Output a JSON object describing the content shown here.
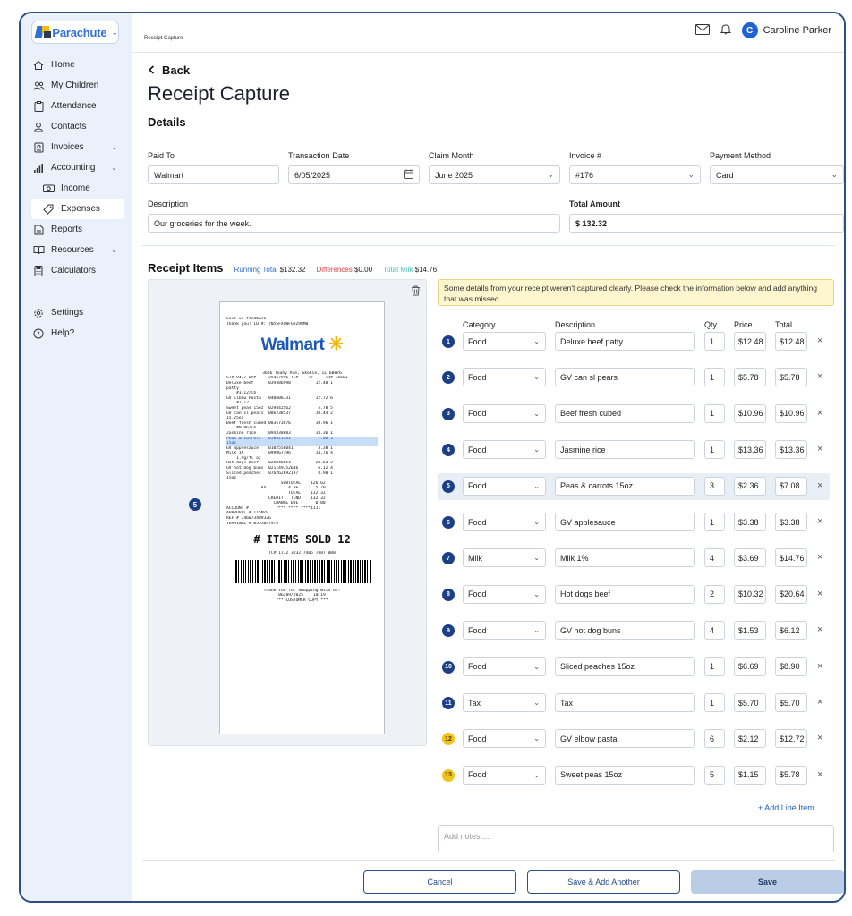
{
  "brand": {
    "name": "Parachute",
    "sub": "by brillant"
  },
  "sidebar": {
    "items": [
      {
        "label": "Home",
        "icon": "home-icon"
      },
      {
        "label": "My Children",
        "icon": "users-icon"
      },
      {
        "label": "Attendance",
        "icon": "clipboard-icon"
      },
      {
        "label": "Contacts",
        "icon": "user-icon"
      },
      {
        "label": "Invoices",
        "icon": "invoice-icon"
      },
      {
        "label": "Accounting",
        "icon": "bar-chart-icon"
      },
      {
        "label": "Income",
        "icon": "cash-icon"
      },
      {
        "label": "Expenses",
        "icon": "tag-icon"
      },
      {
        "label": "Reports",
        "icon": "report-icon"
      },
      {
        "label": "Resources",
        "icon": "book-icon"
      },
      {
        "label": "Calculators",
        "icon": "calculator-icon"
      },
      {
        "label": "Settings",
        "icon": "gear-icon"
      },
      {
        "label": "Help?",
        "icon": "help-icon"
      }
    ]
  },
  "topbar": {
    "breadcrumb": "Receipt Capture",
    "avatar_initial": "C",
    "user_name": "Caroline Parker"
  },
  "page": {
    "back": "Back",
    "title": "Receipt Capture",
    "details_title": "Details"
  },
  "details": {
    "paid_to_label": "Paid To",
    "paid_to": "Walmart",
    "transaction_date_label": "Transaction Date",
    "transaction_date": "6/05/2025",
    "claim_month_label": "Claim Month",
    "claim_month": "June 2025",
    "invoice_label": "Invoice #",
    "invoice": "#176",
    "payment_method_label": "Payment Method",
    "payment_method": "Card",
    "description_label": "Description",
    "description": "Our groceries for the week.",
    "total_label": "Total Amount",
    "total": "$ 132.32"
  },
  "items_header": {
    "title": "Receipt Items",
    "running_total_label": "Running Total",
    "running_total": "$132.32",
    "differences_label": "Differences",
    "differences": "$0.00",
    "total_milk_label": "Total Milk",
    "total_milk": "$14.76"
  },
  "warning": "Some details from your receipt weren't captured clearly. Please check the information below and add anything that was missed.",
  "columns": {
    "category": "Category",
    "description": "Description",
    "qty": "Qty",
    "price": "Price",
    "total": "Total"
  },
  "line_items": [
    {
      "n": "1",
      "category": "Food",
      "description": "Deluxe beef patty",
      "qty": "1",
      "price": "$12.48",
      "total": "$12.48"
    },
    {
      "n": "2",
      "category": "Food",
      "description": "GV can sl pears",
      "qty": "1",
      "price": "$5.78",
      "total": "$5.78"
    },
    {
      "n": "3",
      "category": "Food",
      "description": "Beef fresh cubed",
      "qty": "1",
      "price": "$10.96",
      "total": "$10.96"
    },
    {
      "n": "4",
      "category": "Food",
      "description": "Jasmine rice",
      "qty": "1",
      "price": "$13.36",
      "total": "$13.36"
    },
    {
      "n": "5",
      "category": "Food",
      "description": "Peas & carrots 15oz",
      "qty": "3",
      "price": "$2.36",
      "total": "$7.08"
    },
    {
      "n": "6",
      "category": "Food",
      "description": "GV applesauce",
      "qty": "1",
      "price": "$3.38",
      "total": "$3.38"
    },
    {
      "n": "7",
      "category": "Milk",
      "description": "Milk 1%",
      "qty": "4",
      "price": "$3.69",
      "total": "$14.76"
    },
    {
      "n": "8",
      "category": "Food",
      "description": "Hot dogs beef",
      "qty": "2",
      "price": "$10.32",
      "total": "$20.64"
    },
    {
      "n": "9",
      "category": "Food",
      "description": "GV hot dog buns",
      "qty": "4",
      "price": "$1.53",
      "total": "$6.12"
    },
    {
      "n": "10",
      "category": "Food",
      "description": "Sliced peaches 15oz",
      "qty": "1",
      "price": "$6.69",
      "total": "$8.90"
    },
    {
      "n": "11",
      "category": "Tax",
      "description": "Tax",
      "qty": "1",
      "price": "$5.70",
      "total": "$5.70"
    },
    {
      "n": "12",
      "category": "Food",
      "description": "GV elbow pasta",
      "qty": "6",
      "price": "$2.12",
      "total": "$12.72"
    },
    {
      "n": "13",
      "category": "Food",
      "description": "Sweet peas 15oz",
      "qty": "5",
      "price": "$1.15",
      "total": "$5.78"
    }
  ],
  "add_line_item": "+ Add Line Item",
  "notes_placeholder": "Add notes....",
  "buttons": {
    "cancel": "Cancel",
    "save_add": "Save & Add Another",
    "save": "Save"
  },
  "receipt": {
    "header1": "Give us feedback",
    "header2": "Thank you! ID #: 7N5SFXCWFGHZ98MB",
    "logo": "Walmart",
    "address": "3626 Touhy Ave, Skokie, IL 60076",
    "store_line": "ST# 9477 OP#     39467996 TE#    77     TR# 35683",
    "lines": [
      "Deluxe beef      039386998          12.48 1",
      "patty",
      "    #3.12/lb",
      "GV Elbow Pasta   040606731          12.72 6",
      "    #2.12",
      "Sweet peas 15oz  029442562           5.78 5",
      "GV can sl pears  086238537          10.44 2",
      "15.25oz",
      "Beef fresh cubed 083573676          10.96 1",
      "    #9.96/lb",
      "Jasmine rice     094338803          13.36 1"
    ],
    "highlight": "Peas & carrots   058621361           7.08 3",
    "highlight2": "15oz",
    "lines2": [
      "GV applesauce    0102558041          3.38 1",
      "Milk 1%          099067196          14.76 4",
      "    1.9g/fl oz",
      "Hot dogs beef    028840054          20.64 2",
      "GV hot dog buns  021149752646        6.12 4",
      "Sliced peaches   076262892197        8.90 1",
      "15oz",
      "                      SUBTOTAL    126.62",
      "             TAX         4.5%       5.70",
      "                         TOTAL    132.32",
      "                 CREDIT   TEND    132.32",
      "                   CHANGE DUE       0.00",
      "",
      "ACCOUNT #           **** **** ****1111",
      "APPROVAL # 1TSMZ9",
      "REF # 346073489326",
      "TERMINAL # B555047978"
    ],
    "items_sold": "# ITEMS SOLD 12",
    "tc": "TC# 1712 3232 7405 7807 000",
    "thanks": "Thank You for Shopping With Us!",
    "datetime": "06/09/2025    10:19",
    "copy": "*** CUSTOMER COPY ***"
  }
}
